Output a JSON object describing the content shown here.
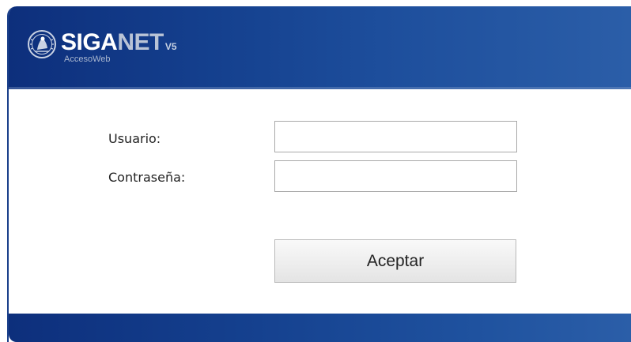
{
  "header": {
    "brand_main": "SIGA",
    "brand_accent": "NET",
    "brand_version": "V5",
    "brand_subtitle": "AccesoWeb",
    "emblem_icon": "seal-emblem-icon"
  },
  "form": {
    "user_label": "Usuario:",
    "user_value": "",
    "password_label": "Contraseña:",
    "password_value": "",
    "submit_label": "Aceptar"
  },
  "colors": {
    "header_blue": "#15418f",
    "footer_blue": "#1f529f",
    "button_bg": "#eeeeee",
    "input_border": "#a9a9a9"
  }
}
